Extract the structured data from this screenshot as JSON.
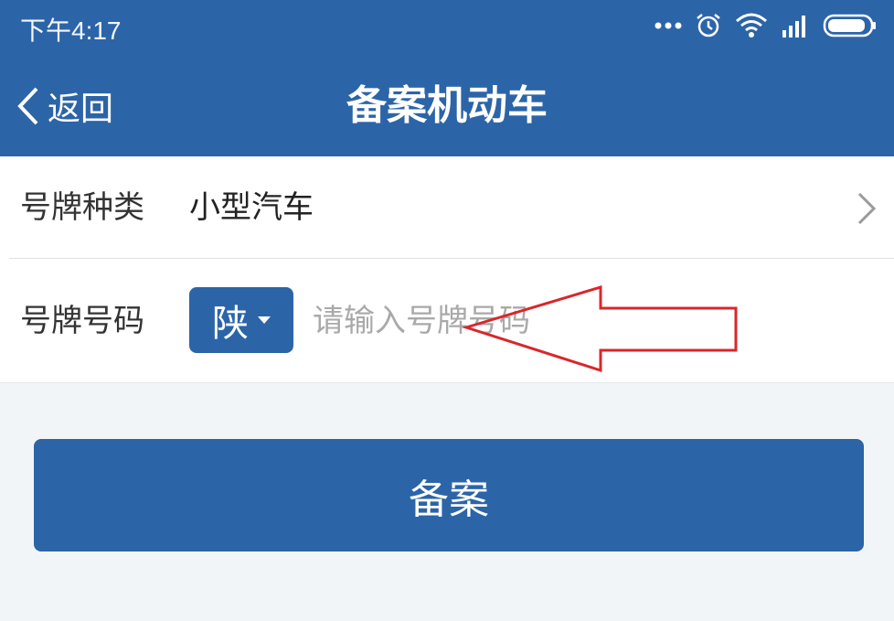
{
  "status_bar": {
    "time": "下午4:17",
    "icons": [
      "more-dots-icon",
      "alarm-icon",
      "wifi-icon",
      "signal-icon",
      "battery-icon"
    ]
  },
  "nav": {
    "back_label": "返回",
    "title": "备案机动车"
  },
  "form": {
    "plate_type": {
      "label": "号牌种类",
      "value": "小型汽车"
    },
    "plate_number": {
      "label": "号牌号码",
      "province": "陕",
      "placeholder": "请输入号牌号码",
      "value": ""
    }
  },
  "submit_label": "备案",
  "colors": {
    "primary": "#2c64a8",
    "background": "#f2f5f7",
    "annotation": "#d9262b"
  }
}
